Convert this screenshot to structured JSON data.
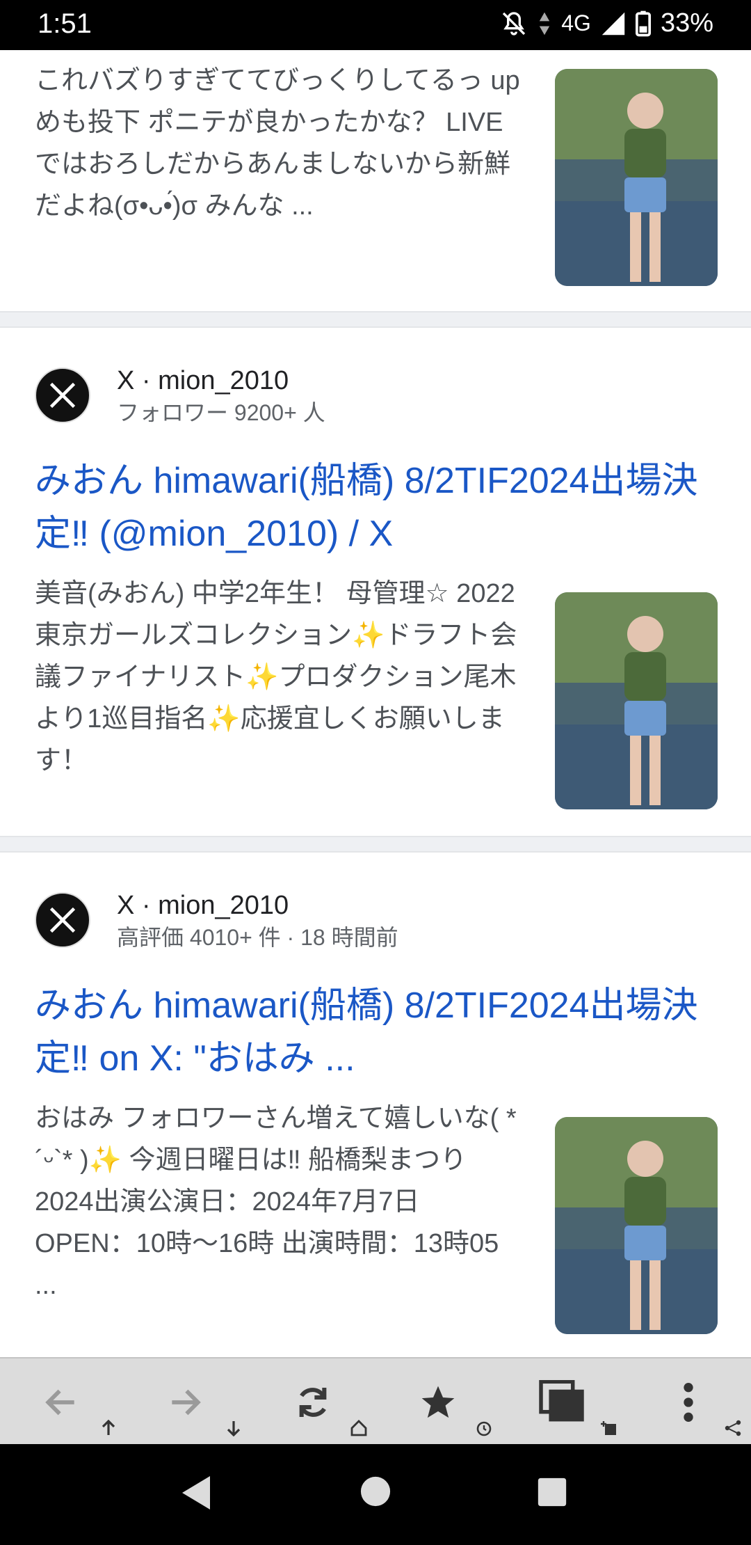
{
  "status_bar": {
    "time": "1:51",
    "network": "4G",
    "battery": "33%",
    "icons": [
      "bell-off-icon",
      "data-arrows-icon",
      "signal-icon",
      "battery-icon"
    ]
  },
  "results": [
    {
      "snippet": "これバズりすぎててびっくりしてるっ upめも投下 ポニテが良かったかな？ LIVEではおろしだからあんましないから新鮮だよね(σ•ᴗ•́)σ みんな ..."
    },
    {
      "source_name": "X · mion_2010",
      "source_meta": "フォロワー 9200+ 人",
      "title": "みおん himawari(船橋) 8/2TIF2024出場決定‼ (@mion_2010) / X",
      "snippet": "美音(みおん) 中学2年生！ 母管理☆ 2022東京ガールズコレクション✨ドラフト会議ファイナリスト✨プロダクション尾木より1巡目指名✨応援宜しくお願いします！"
    },
    {
      "source_name": "X · mion_2010",
      "source_meta": "高評価 4010+ 件 · 18 時間前",
      "title": "みおん himawari(船橋) 8/2TIF2024出場決定‼ on X: \"おはみ ...",
      "snippet": "おはみ フォロワーさん増えて嬉しいな( *´ᵕ`* )✨ 今週日曜日は‼ 船橋梨まつり2024出演公演日：2024年7月7日 OPEN：10時〜16時 出演時間：13時05 ..."
    }
  ],
  "toolbar": {
    "items": [
      "back-icon",
      "forward-icon",
      "reload-icon",
      "bookmark-star-icon",
      "tabs-icon",
      "menu-icon"
    ]
  },
  "nav": {
    "items": [
      "back-triangle-icon",
      "home-circle-icon",
      "recents-square-icon"
    ]
  },
  "colors": {
    "link": "#1a57c6",
    "snippet": "#4d5156",
    "toolbar_bg": "#dcdcdc",
    "divider": "#eef0f3"
  }
}
